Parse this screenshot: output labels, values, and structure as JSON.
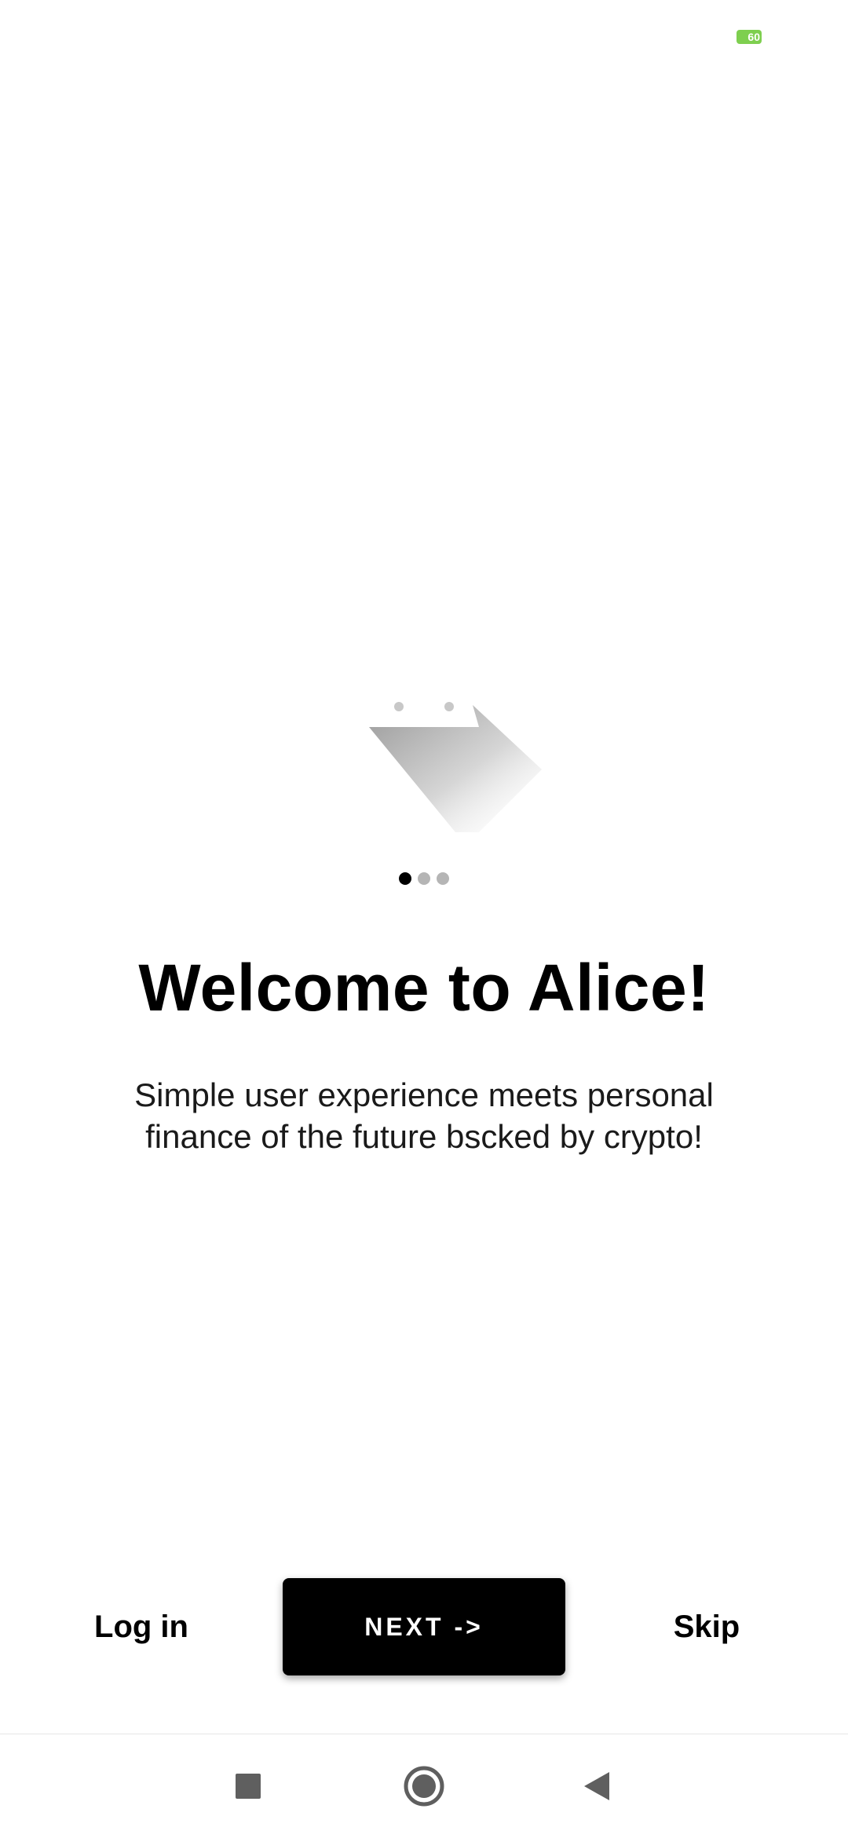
{
  "status_bar": {
    "battery_level": "60",
    "battery_color": "#7ecf4f"
  },
  "onboarding": {
    "illustration": "sliding-arrow-illustration",
    "page_indicator": {
      "total": 3,
      "active_index": 0
    },
    "title": "Welcome to Alice!",
    "subtitle": "Simple user experience meets personal finance of the future bscked by crypto!"
  },
  "actions": {
    "login_label": "Log in",
    "next_label": "NEXT ->",
    "skip_label": "Skip"
  },
  "nav_bar": {
    "recents_icon": "square-icon",
    "home_icon": "circle-icon",
    "back_icon": "triangle-back-icon"
  },
  "colors": {
    "primary_button": "#000000",
    "primary_button_text": "#ffffff",
    "dot_active": "#000000",
    "dot_inactive": "#b5b5b5"
  }
}
